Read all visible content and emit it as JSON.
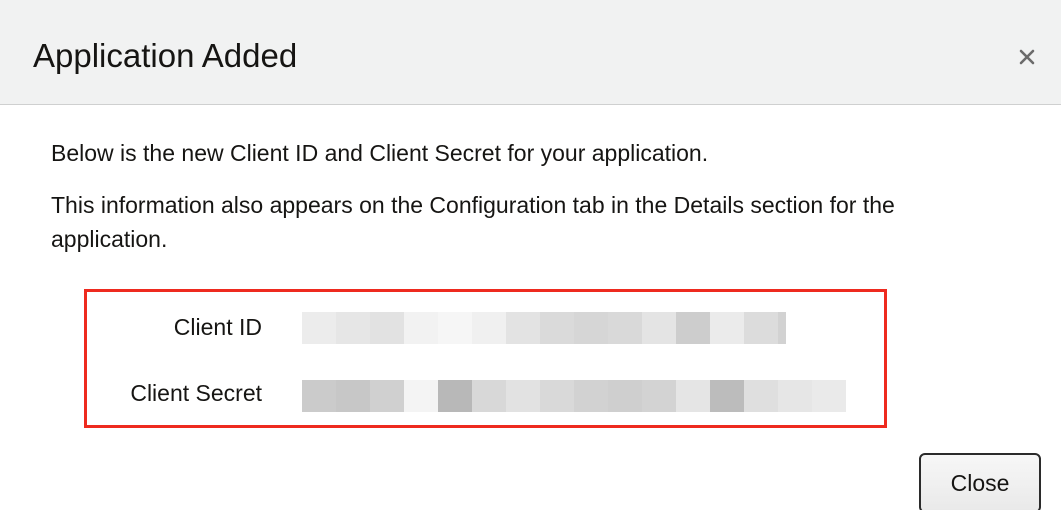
{
  "dialog": {
    "title": "Application Added",
    "close_icon": "close-x-icon",
    "paragraph_1": "Below is the new Client ID and Client Secret for your application.",
    "paragraph_2": "This information also appears on the Configuration tab in the Details section for the application.",
    "credentials": {
      "client_id_label": "Client ID",
      "client_secret_label": "Client Secret",
      "client_id_value_state": "redacted (pixelated)",
      "client_secret_value_state": "redacted (pixelated)"
    },
    "close_button_label": "Close"
  },
  "colors": {
    "header_bg": "#f1f2f2",
    "highlight_border": "#ee2a1f",
    "text": "#161513"
  }
}
